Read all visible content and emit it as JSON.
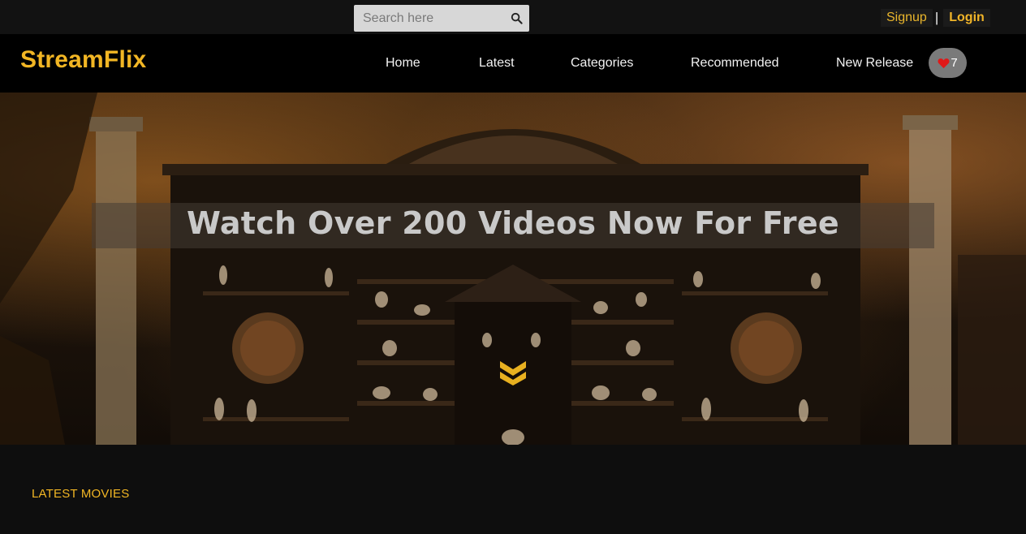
{
  "search": {
    "placeholder": "Search here",
    "icon": "search-icon"
  },
  "auth": {
    "signup_label": "Signup",
    "separator": "|",
    "login_label": "Login"
  },
  "brand": {
    "name": "StreamFlix",
    "color": "#f2b624"
  },
  "nav": {
    "items": [
      {
        "label": "Home"
      },
      {
        "label": "Latest"
      },
      {
        "label": "Categories"
      },
      {
        "label": "Recommended"
      },
      {
        "label": "New Release"
      }
    ],
    "favorites": {
      "icon": "heart-icon",
      "count": "7"
    }
  },
  "hero": {
    "title": "Watch Over 200 Videos Now For Free",
    "scroll_icon": "double-chevron-down-icon"
  },
  "sections": {
    "latest_heading": "LATEST MOVIES"
  }
}
